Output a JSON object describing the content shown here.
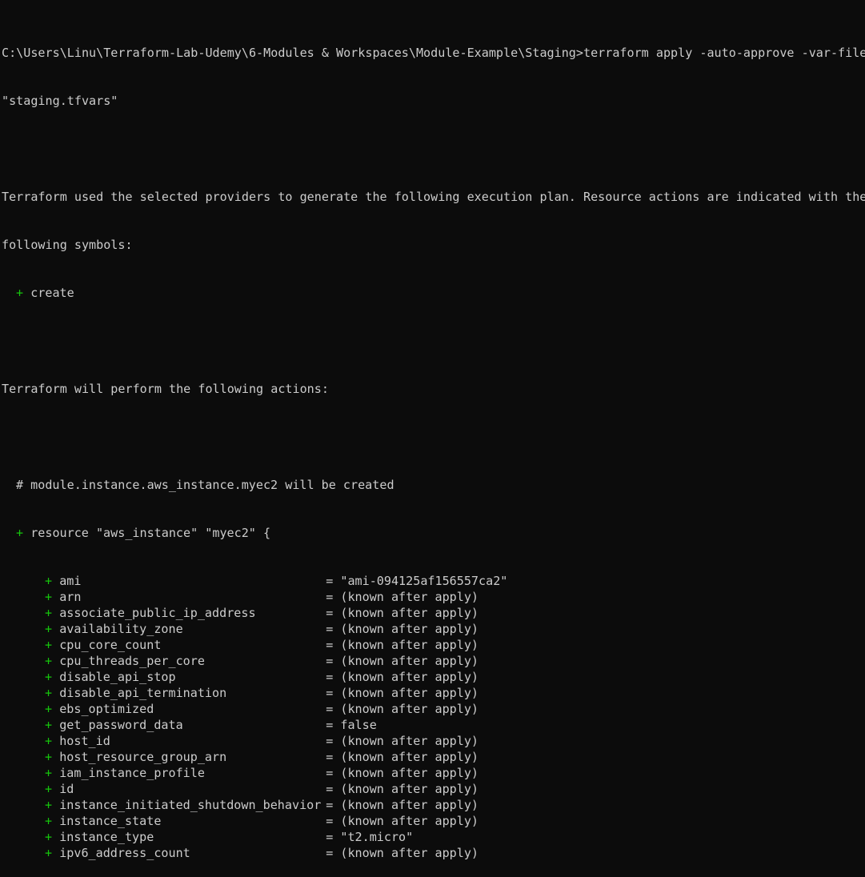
{
  "command_line": {
    "prompt": "C:\\Users\\Linu\\Terraform-Lab-Udemy\\6-Modules & Workspaces\\Module-Example\\Staging>",
    "command": "terraform apply -auto-approve -var-file=",
    "command_cont": "\"staging.tfvars\""
  },
  "intro": {
    "line1": "Terraform used the selected providers to generate the following execution plan. Resource actions are indicated with the",
    "line2": "following symbols:",
    "symbol": "+",
    "symbol_label": "create"
  },
  "actions_header": "Terraform will perform the following actions:",
  "resource": {
    "comment": "# module.instance.aws_instance.myec2 will be created",
    "symbol": "+",
    "declaration": "resource \"aws_instance\" \"myec2\" {"
  },
  "attributes": [
    {
      "symbol": "+",
      "name": "ami",
      "value": "= \"ami-094125af156557ca2\""
    },
    {
      "symbol": "+",
      "name": "arn",
      "value": "= (known after apply)"
    },
    {
      "symbol": "+",
      "name": "associate_public_ip_address",
      "value": "= (known after apply)"
    },
    {
      "symbol": "+",
      "name": "availability_zone",
      "value": "= (known after apply)"
    },
    {
      "symbol": "+",
      "name": "cpu_core_count",
      "value": "= (known after apply)"
    },
    {
      "symbol": "+",
      "name": "cpu_threads_per_core",
      "value": "= (known after apply)"
    },
    {
      "symbol": "+",
      "name": "disable_api_stop",
      "value": "= (known after apply)"
    },
    {
      "symbol": "+",
      "name": "disable_api_termination",
      "value": "= (known after apply)"
    },
    {
      "symbol": "+",
      "name": "ebs_optimized",
      "value": "= (known after apply)"
    },
    {
      "symbol": "+",
      "name": "get_password_data",
      "value": "= false"
    },
    {
      "symbol": "+",
      "name": "host_id",
      "value": "= (known after apply)"
    },
    {
      "symbol": "+",
      "name": "host_resource_group_arn",
      "value": "= (known after apply)"
    },
    {
      "symbol": "+",
      "name": "iam_instance_profile",
      "value": "= (known after apply)"
    },
    {
      "symbol": "+",
      "name": "id",
      "value": "= (known after apply)"
    },
    {
      "symbol": "+",
      "name": "instance_initiated_shutdown_behavior",
      "value": "= (known after apply)"
    },
    {
      "symbol": "+",
      "name": "instance_state",
      "value": "= (known after apply)"
    },
    {
      "symbol": "+",
      "name": "instance_type",
      "value": "= \"t2.micro\""
    },
    {
      "symbol": "+",
      "name": "ipv6_address_count",
      "value": "= (known after apply)"
    }
  ],
  "colors": {
    "background": "#0c0c0c",
    "text": "#cccccc",
    "create_symbol": "#16c60c"
  }
}
